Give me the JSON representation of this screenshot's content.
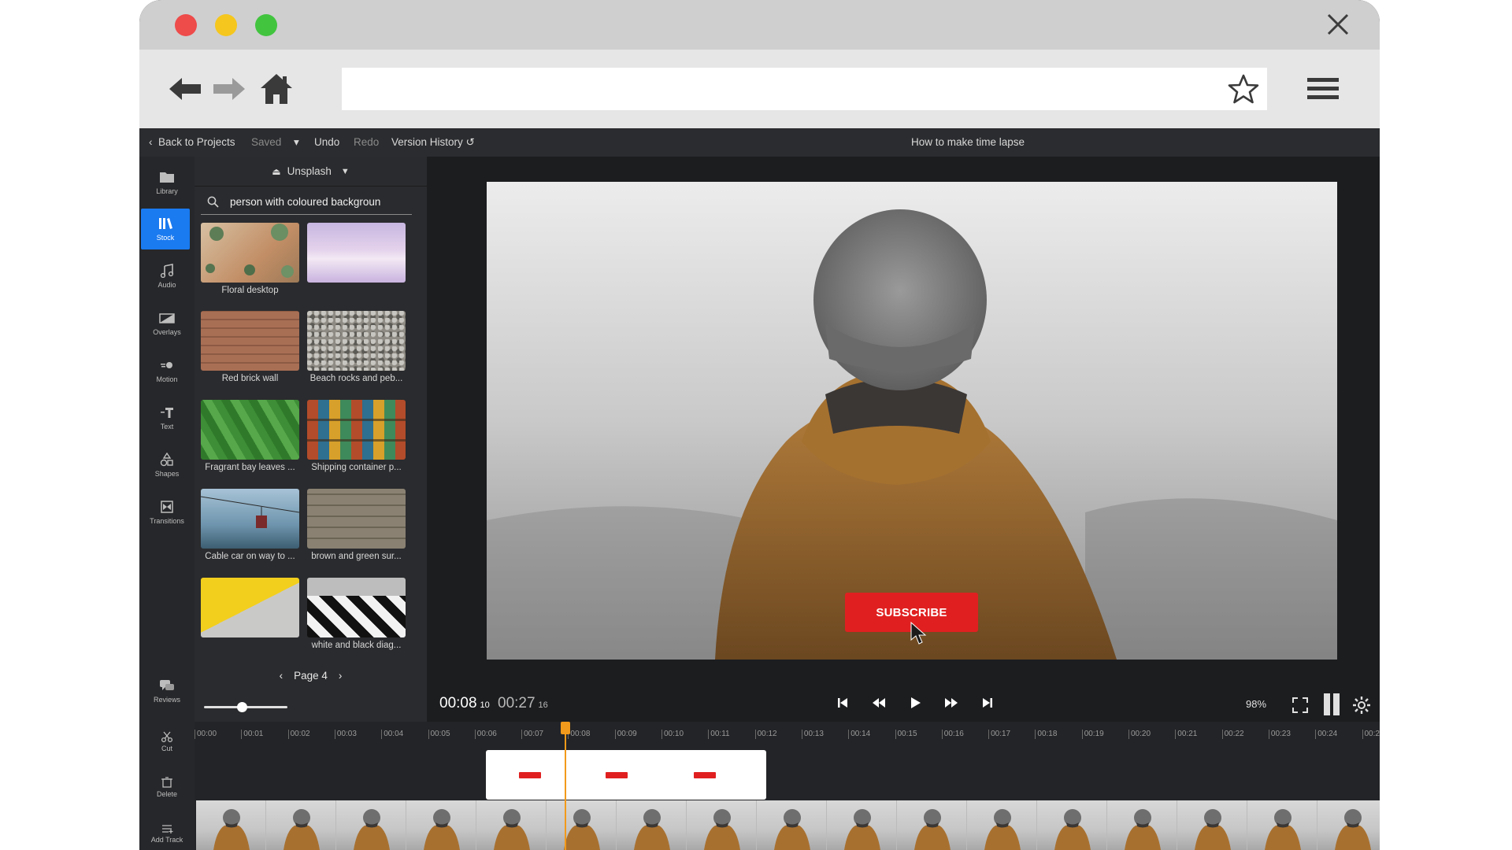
{
  "browser": {
    "url": ""
  },
  "app": {
    "back_label": "Back to Projects",
    "saved_label": "Saved",
    "undo_label": "Undo",
    "redo_label": "Redo",
    "version_history_label": "Version History",
    "project_title": "How to make time lapse"
  },
  "sidebar": {
    "items": [
      {
        "label": "Library",
        "icon": "folder-icon"
      },
      {
        "label": "Stock",
        "icon": "stock-books-icon",
        "active": true
      },
      {
        "label": "Audio",
        "icon": "music-note-icon"
      },
      {
        "label": "Overlays",
        "icon": "overlay-icon"
      },
      {
        "label": "Motion",
        "icon": "motion-icon"
      },
      {
        "label": "Text",
        "icon": "text-icon"
      },
      {
        "label": "Shapes",
        "icon": "shapes-icon"
      },
      {
        "label": "Transitions",
        "icon": "transitions-icon"
      },
      {
        "label": "Reviews",
        "icon": "reviews-icon"
      }
    ]
  },
  "media_panel": {
    "source": "Unsplash",
    "search_value": "person with coloured backgroun",
    "page_label": "Page 4",
    "thumbnails": [
      {
        "label": "Floral desktop",
        "color": "#c9a27f"
      },
      {
        "label": "",
        "color": "#d8c5e6"
      },
      {
        "label": "Red brick wall",
        "color": "#a56e53"
      },
      {
        "label": "Beach rocks and peb...",
        "color": "#8d8c86"
      },
      {
        "label": "Fragrant bay leaves ...",
        "color": "#3f8d3a"
      },
      {
        "label": "Shipping container p...",
        "color": "#9a5f2c"
      },
      {
        "label": "Cable car on way to ...",
        "color": "#6b8fa3"
      },
      {
        "label": "brown and green sur...",
        "color": "#827a6a"
      },
      {
        "label": "",
        "color": "#f2cf1d"
      },
      {
        "label": "white and black diag...",
        "color": "#202020"
      }
    ]
  },
  "preview": {
    "subscribe_label": "SUBSCRIBE",
    "current_time": "00:08",
    "current_frame": "10",
    "total_time": "00:27",
    "total_frame": "16",
    "zoom": "98%"
  },
  "timeline": {
    "tools": [
      {
        "label": "Cut",
        "icon": "scissors-icon"
      },
      {
        "label": "Delete",
        "icon": "trash-icon"
      },
      {
        "label": "Add Track",
        "icon": "add-track-icon"
      }
    ],
    "ticks": [
      "00:00",
      "00:01",
      "00:02",
      "00:03",
      "00:04",
      "00:05",
      "00:06",
      "00:07",
      "00:08",
      "00:09",
      "00:10",
      "00:11",
      "00:12",
      "00:13",
      "00:14",
      "00:15",
      "00:16",
      "00:17",
      "00:18",
      "00:19",
      "00:20",
      "00:21",
      "00:22",
      "00:23",
      "00:24",
      "00:2"
    ]
  }
}
